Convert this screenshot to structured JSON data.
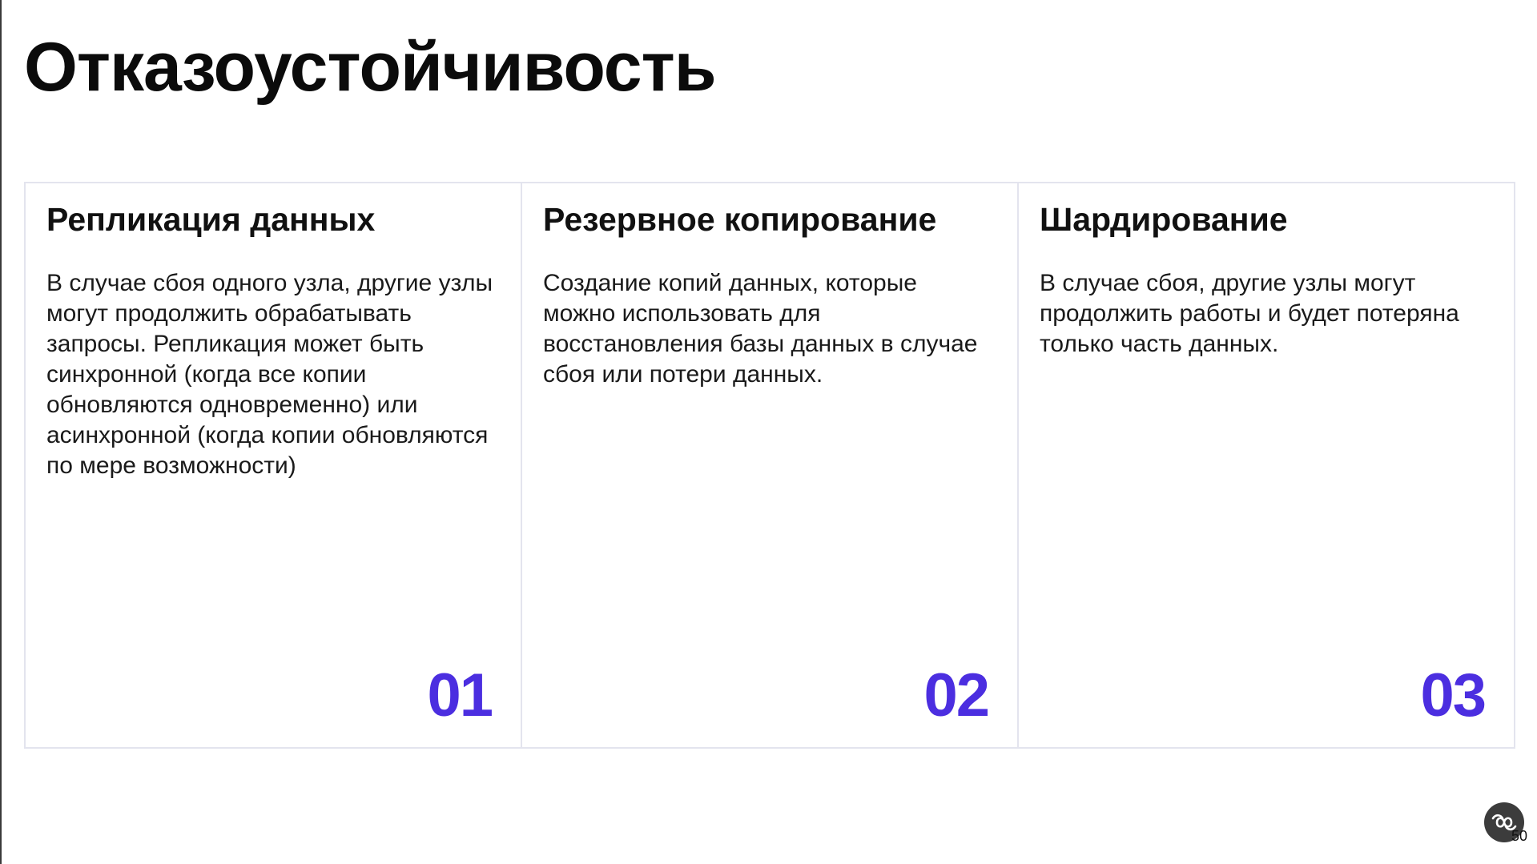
{
  "slide": {
    "title": "Отказоустойчивость",
    "page_number": "50",
    "accent_color": "#4b2ee0"
  },
  "cards": [
    {
      "title": "Репликация данных",
      "text": "В случае сбоя одного узла, другие узлы могут продолжить обрабатывать запросы. Репликация может быть синхронной (когда все копии обновляются одновременно) или асинхронной (когда копии обновляются по мере возможности)",
      "number": "01"
    },
    {
      "title": "Резервное копирование",
      "text": "Создание копий данных, которые можно использовать для восстановления базы данных в случае сбоя или потери данных.",
      "number": "02"
    },
    {
      "title": "Шардирование",
      "text": "В случае сбоя, другие узлы могут продолжить работы и будет потеряна только часть данных.",
      "number": "03"
    }
  ],
  "logo": {
    "icon": "interlinked-loops-logo-icon"
  }
}
